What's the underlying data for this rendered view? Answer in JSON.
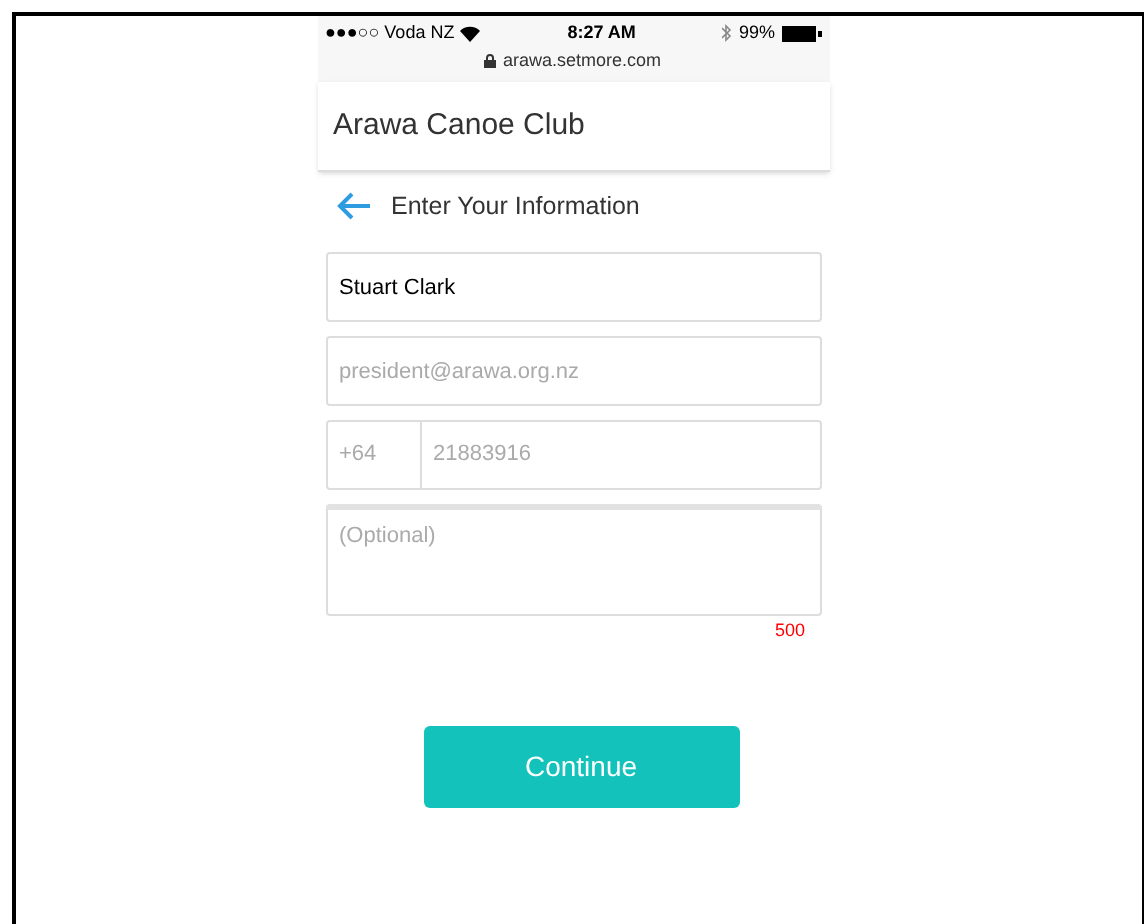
{
  "status_bar": {
    "carrier": "●●●○○ Voda NZ",
    "time": "8:27 AM",
    "battery": "99%",
    "url": "arawa.setmore.com"
  },
  "header": {
    "title": "Arawa Canoe Club"
  },
  "page": {
    "title": "Enter Your Information"
  },
  "form": {
    "name": {
      "value": "Stuart Clark"
    },
    "email": {
      "placeholder": "president@arawa.org.nz"
    },
    "phone": {
      "country_code": "+64",
      "placeholder": "21883916"
    },
    "notes": {
      "placeholder": "(Optional)",
      "remaining": "500"
    }
  },
  "continue_button": "Continue"
}
